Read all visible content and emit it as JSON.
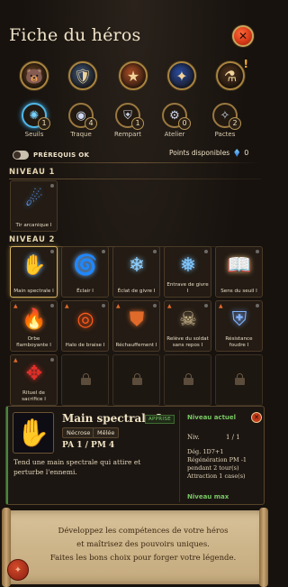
{
  "title": "Fiche du héros",
  "emblems": [
    {
      "icon": "bear-helmet-icon",
      "glyph": "🐻",
      "bg": "#5a3a1e",
      "alert": ""
    },
    {
      "icon": "shield-icon",
      "glyph": "🛡",
      "bg": "#3a5070",
      "alert": ""
    },
    {
      "icon": "star-badge-icon",
      "glyph": "★",
      "bg": "#a24a24",
      "alert": ""
    },
    {
      "icon": "blue-crystal-icon",
      "glyph": "✦",
      "bg": "#27499a",
      "alert": ""
    },
    {
      "icon": "cauldron-icon",
      "glyph": "⚗",
      "bg": "#4a2f1c",
      "alert": "!"
    }
  ],
  "categories": [
    {
      "label": "Seuils",
      "count": "1",
      "icon": "rune-circle-icon",
      "glyph": "✺",
      "active": true
    },
    {
      "label": "Traque",
      "count": "4",
      "icon": "eye-icon",
      "glyph": "◉",
      "active": false
    },
    {
      "label": "Rempart",
      "count": "1",
      "icon": "helmet-icon",
      "glyph": "⛨",
      "active": false
    },
    {
      "label": "Atelier",
      "count": "0",
      "icon": "gear-icon",
      "glyph": "⚙",
      "active": false
    },
    {
      "label": "Pactes",
      "count": "2",
      "icon": "scroll-icon",
      "glyph": "✧",
      "active": false
    }
  ],
  "prereq_label": "PRÉREQUIS OK",
  "points_label": "Points disponibles",
  "points_value": "0",
  "level1": {
    "title": "NIVEAU 1",
    "skills": [
      {
        "name": "Tir arcanique I",
        "icon": "arcane-bolt-icon",
        "glyph": "☄",
        "color": "#5aa0ff"
      }
    ]
  },
  "level2": {
    "title": "NIVEAU 2",
    "skills": [
      {
        "name": "Main spectrale I",
        "icon": "spectral-hand-icon",
        "glyph": "✋",
        "color": "#6fb4ff",
        "selected": true,
        "flame": false,
        "locked": false
      },
      {
        "name": "Éclair I",
        "icon": "lightning-vortex-icon",
        "glyph": "🌀",
        "color": "#6fb4ff",
        "flame": false,
        "locked": false
      },
      {
        "name": "Éclat de givre I",
        "icon": "frost-shard-icon",
        "glyph": "❄",
        "color": "#8fd0ff",
        "flame": false,
        "locked": false
      },
      {
        "name": "Entrave de givre I",
        "icon": "frost-bind-icon",
        "glyph": "❅",
        "color": "#7fc7ff",
        "flame": false,
        "locked": false
      },
      {
        "name": "Sens du seuil I",
        "icon": "spellbook-icon",
        "glyph": "📖",
        "color": "#c8a46a",
        "flame": false,
        "locked": false
      },
      {
        "name": "Orbe flamboyante I",
        "icon": "fire-orb-icon",
        "glyph": "🔥",
        "color": "#ff7a2a",
        "flame": true,
        "locked": false
      },
      {
        "name": "Halo de braise I",
        "icon": "ember-halo-icon",
        "glyph": "◎",
        "color": "#ff5a1a",
        "flame": true,
        "locked": false
      },
      {
        "name": "Réchauffement I",
        "icon": "fire-shield-icon",
        "glyph": "⛊",
        "color": "#e06a2a",
        "flame": true,
        "locked": false
      },
      {
        "name": "Relève du soldat sans repos I",
        "icon": "undead-soldier-icon",
        "glyph": "☠",
        "color": "#c9b48a",
        "flame": true,
        "locked": false
      },
      {
        "name": "Résistance foudre I",
        "icon": "lightning-shield-icon",
        "glyph": "⛨",
        "color": "#7fb0ff",
        "flame": true,
        "locked": false
      },
      {
        "name": "Rituel de sacrifice I",
        "icon": "blood-ritual-icon",
        "glyph": "✥",
        "color": "#e0302a",
        "flame": true,
        "locked": false
      },
      {
        "name": "",
        "icon": "lock-icon",
        "locked": true
      },
      {
        "name": "",
        "icon": "lock-icon",
        "locked": true
      },
      {
        "name": "",
        "icon": "lock-icon",
        "locked": true
      },
      {
        "name": "",
        "icon": "lock-icon",
        "locked": true
      }
    ]
  },
  "detail": {
    "name": "Main spectrale I",
    "tag": "APPRISE",
    "chips": [
      "Nécrose",
      "Mêlée"
    ],
    "pa_pm": "PA 1 / PM 4",
    "description": "Tend une main spectrale qui attire et perturbe l'ennemi.",
    "niveau_actuel": "Niveau actuel",
    "niv_label": "Niv.",
    "niv_value": "1 / 1",
    "stats": [
      "Dég. 1D7+1",
      "Régénération PM -1 pendant 2 tour(s)",
      "Attraction 1 case(s)"
    ],
    "niveau_max": "Niveau max"
  },
  "banner": {
    "lines": [
      "Développez les compétences de votre héros",
      "et maîtrisez des pouvoirs uniques.",
      "Faites les bons choix pour forger votre légende."
    ]
  }
}
